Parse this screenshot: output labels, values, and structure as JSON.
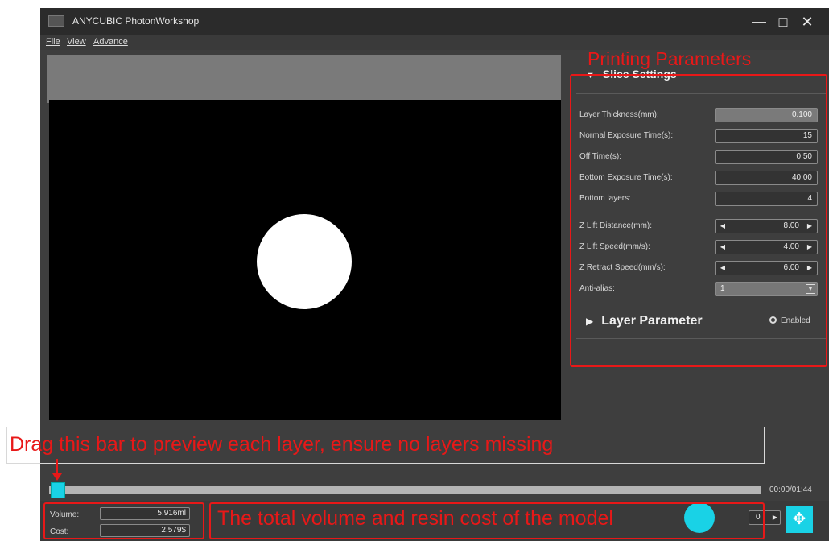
{
  "window": {
    "title": "ANYCUBIC PhotonWorkshop",
    "controls": {
      "minimize": "—",
      "maximize": "□",
      "close": "✕"
    }
  },
  "menu": [
    "File",
    "View",
    "Advance"
  ],
  "slice_settings": {
    "header": "Slice Settings",
    "params": [
      {
        "label": "Layer Thickness(mm):",
        "value": "0.100",
        "type": "readonly"
      },
      {
        "label": "Normal Exposure Time(s):",
        "value": "15",
        "type": "input"
      },
      {
        "label": "Off Time(s):",
        "value": "0.50",
        "type": "input"
      },
      {
        "label": "Bottom Exposure Time(s):",
        "value": "40.00",
        "type": "input"
      },
      {
        "label": "Bottom layers:",
        "value": "4",
        "type": "input"
      },
      {
        "label": "Z Lift Distance(mm):",
        "value": "8.00",
        "type": "stepper"
      },
      {
        "label": "Z Lift Speed(mm/s):",
        "value": "4.00",
        "type": "stepper"
      },
      {
        "label": "Z Retract Speed(mm/s):",
        "value": "6.00",
        "type": "stepper"
      },
      {
        "label": "Anti-alias:",
        "value": "1",
        "type": "select"
      }
    ]
  },
  "layer_parameter": {
    "label": "Layer Parameter",
    "enabled_label": "Enabled"
  },
  "preview": {
    "time": "00:00/01:44"
  },
  "stats": {
    "volume_label": "Volume:",
    "volume_value": "5.916ml",
    "cost_label": "Cost:",
    "cost_value": "2.579$"
  },
  "bottom_controls": {
    "layer_value": "0"
  },
  "annotations": {
    "printing_parameters": "Printing Parameters",
    "drag_bar": "Drag this bar to preview each layer, ensure no layers missing",
    "total_volume": "The total volume and resin cost of the model"
  },
  "colors": {
    "annotation": "#e81818",
    "accent": "#19d2e6",
    "window_bg": "#3e3e3e",
    "viewport": "#000000"
  },
  "icons": {
    "app": "app-logo-icon",
    "expand": "triangle-down-icon",
    "collapse": "triangle-right-icon",
    "move": "move-arrows-icon"
  }
}
